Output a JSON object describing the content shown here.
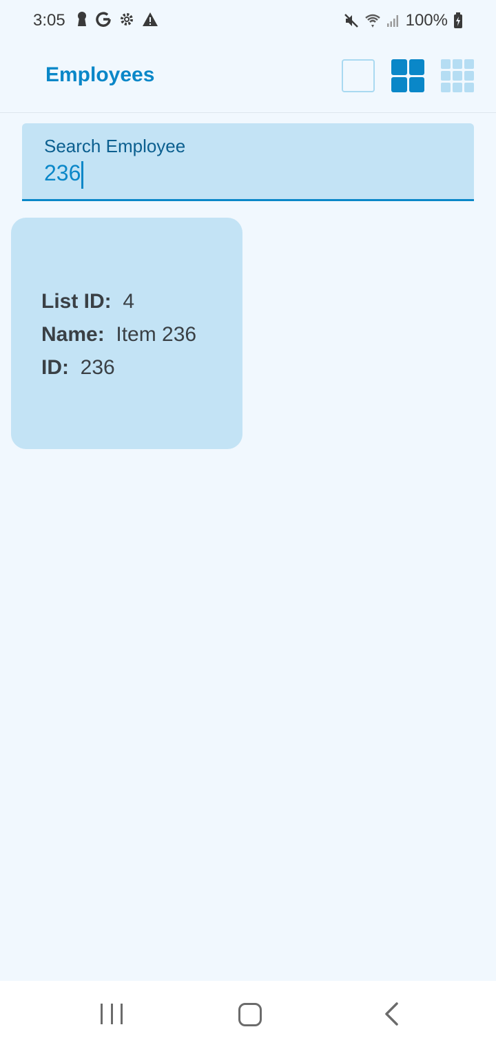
{
  "status_bar": {
    "time": "3:05",
    "battery_text": "100%",
    "left_icons": [
      "keyhole-icon",
      "google-icon",
      "settings-icon",
      "warning-icon"
    ],
    "right_icons": [
      "mute-icon",
      "wifi-icon",
      "signal-icon",
      "battery-charging-icon"
    ]
  },
  "app_bar": {
    "title": "Employees",
    "layout_options": [
      "single-column",
      "two-column",
      "three-column"
    ],
    "selected_layout": "two-column"
  },
  "search": {
    "label": "Search Employee",
    "value": "236"
  },
  "results": [
    {
      "list_id_label": "List ID:",
      "list_id": "4",
      "name_label": "Name:",
      "name": "Item 236",
      "id_label": "ID:",
      "id": "236"
    }
  ],
  "colors": {
    "accent": "#0a87c8",
    "background": "#f1f8fe",
    "card": "#c3e3f5"
  }
}
